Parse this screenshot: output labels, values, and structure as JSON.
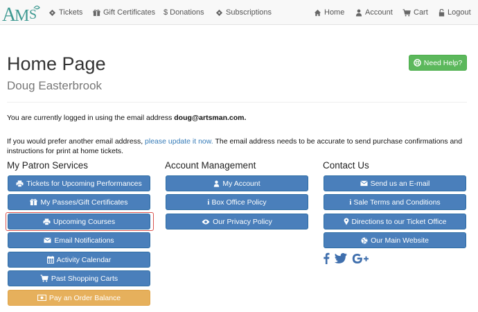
{
  "brand": {
    "logo_text": "AMS"
  },
  "nav": {
    "left": [
      {
        "label": "Tickets",
        "icon": "ticket-icon"
      },
      {
        "label": "Gift Certificates",
        "icon": "gift-icon"
      },
      {
        "label": "Donations",
        "icon": "dollar-icon"
      },
      {
        "label": "Subscriptions",
        "icon": "tag-icon"
      }
    ],
    "right": [
      {
        "label": "Home",
        "icon": "home-icon"
      },
      {
        "label": "Account",
        "icon": "user-icon"
      },
      {
        "label": "Cart",
        "icon": "cart-icon"
      },
      {
        "label": "Logout",
        "icon": "lock-icon"
      }
    ]
  },
  "header": {
    "title": "Home Page",
    "patron_name": "Doug Easterbrook",
    "help_button": "Need Help?"
  },
  "intro": {
    "login_text": "You are currently logged in using the email address",
    "email": "doug@artsman.com.",
    "update_prefix": "If you would prefer another email address,",
    "update_link": "please update it now.",
    "update_suffix": "The email address needs to be accurate to send purchase confirmations and instructions for print at home tickets."
  },
  "patron_services": {
    "heading": "My Patron Services",
    "buttons": [
      {
        "label": "Tickets for Upcoming Performances",
        "icon": "print-icon"
      },
      {
        "label": "My Passes/Gift Certificates",
        "icon": "gift-icon"
      },
      {
        "label": "Upcoming Courses",
        "icon": "print-icon"
      },
      {
        "label": "Email Notifications",
        "icon": "envelope-icon"
      },
      {
        "label": "Activity Calendar",
        "icon": "calendar-icon"
      },
      {
        "label": "Past Shopping Carts",
        "icon": "cart-icon"
      },
      {
        "label": "Pay an Order Balance",
        "icon": "money-icon"
      }
    ]
  },
  "account_management": {
    "heading": "Account Management",
    "buttons": [
      {
        "label": "My Account",
        "icon": "user-icon"
      },
      {
        "label": "Box Office Policy",
        "icon": "info-icon"
      },
      {
        "label": "Our Privacy Policy",
        "icon": "eye-icon"
      }
    ]
  },
  "contact": {
    "heading": "Contact Us",
    "buttons": [
      {
        "label": "Send us an E-mail",
        "icon": "envelope-icon"
      },
      {
        "label": "Sale Terms and Conditions",
        "icon": "info-icon"
      },
      {
        "label": "Directions to our Ticket Office",
        "icon": "map-marker-icon"
      },
      {
        "label": "Our Main Website",
        "icon": "globe-icon"
      }
    ],
    "social": [
      "facebook-icon",
      "twitter-icon",
      "google-plus-icon"
    ]
  },
  "colors": {
    "primary": "#4a7fbb",
    "success": "#5cb85c",
    "warning": "#e6b05c",
    "link": "#337ab7",
    "highlight": "#d9534f"
  }
}
